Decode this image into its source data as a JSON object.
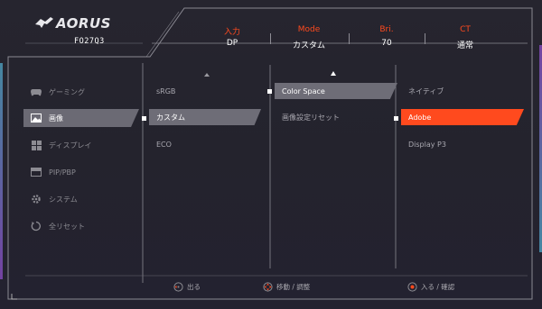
{
  "brand": {
    "logo_text": "AORUS",
    "model": "FO27Q3"
  },
  "status": [
    {
      "label": "入力",
      "value": "DP"
    },
    {
      "label": "Mode",
      "value": "カスタム"
    },
    {
      "label": "Bri.",
      "value": "70"
    },
    {
      "label": "CT",
      "value": "通常"
    }
  ],
  "sidebar": {
    "items": [
      {
        "label": "ゲーミング",
        "icon": "gamepad-icon"
      },
      {
        "label": "画像",
        "icon": "picture-icon"
      },
      {
        "label": "ディスプレイ",
        "icon": "grid-icon"
      },
      {
        "label": "PIP/PBP",
        "icon": "pip-icon"
      },
      {
        "label": "システム",
        "icon": "gear-icon"
      },
      {
        "label": "全リセット",
        "icon": "reset-icon"
      }
    ]
  },
  "col2": {
    "items": [
      "sRGB",
      "カスタム",
      "ECO"
    ]
  },
  "col3": {
    "items": [
      "Color Space",
      "画像設定リセット"
    ]
  },
  "col4": {
    "items": [
      "ネイティブ",
      "Adobe",
      "Display P3"
    ]
  },
  "footer": {
    "exit": "出る",
    "move": "移動 / 調整",
    "confirm": "入る / 確認"
  },
  "colors": {
    "accent": "#ff4a1e",
    "highlight": "#6e6d77"
  }
}
